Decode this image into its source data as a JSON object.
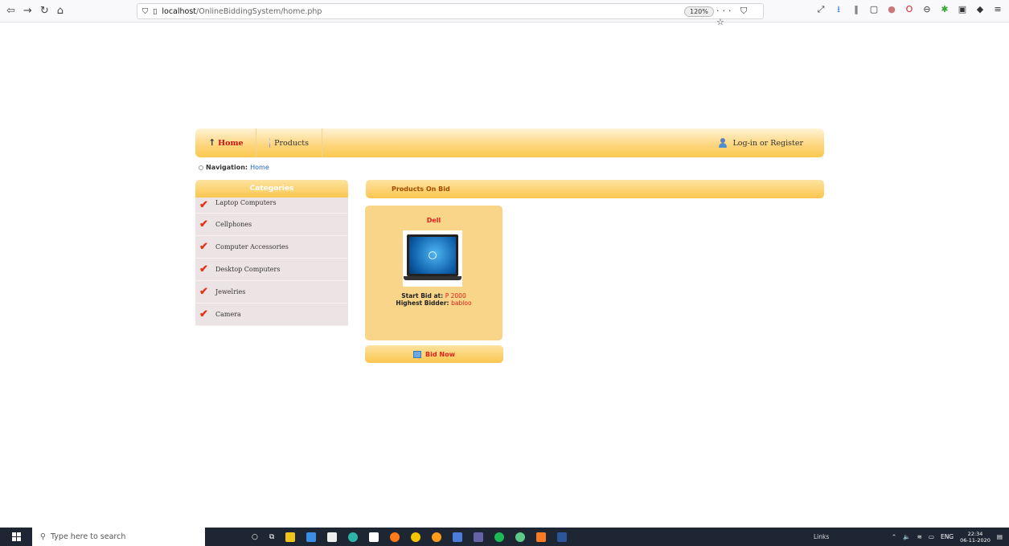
{
  "browser": {
    "url_host": "localhost",
    "url_path": "/OnlineBiddingSystem/home.php",
    "zoom": "120%",
    "back_icon": "back-arrow-icon",
    "forward_icon": "forward-arrow-icon",
    "reload_icon": "reload-icon",
    "home_icon": "home-icon"
  },
  "topnav": {
    "home_label": "Home",
    "products_label": "Products",
    "login_label": "Log-in or Register"
  },
  "breadcrumb": {
    "label": "Navigation:",
    "current": "Home"
  },
  "sidebar": {
    "header": "Categories",
    "items": [
      {
        "label": "Laptop Computers"
      },
      {
        "label": "Cellphones"
      },
      {
        "label": "Computer Accessories"
      },
      {
        "label": "Desktop Computers"
      },
      {
        "label": "Jewelries"
      },
      {
        "label": "Camera"
      }
    ]
  },
  "main": {
    "header": "Products On Bid",
    "product": {
      "name": "Dell",
      "start_bid_label": "Start Bid at:",
      "start_bid_value": "P 2000",
      "highest_bidder_label": "Highest Bidder:",
      "highest_bidder_value": "babloo",
      "bid_button": "Bid Now"
    }
  },
  "taskbar": {
    "search_placeholder": "Type here to search",
    "links": "Links",
    "lang": "ENG",
    "time": "22:34",
    "date": "06-11-2020"
  },
  "colors": {
    "nav_gradient_top": "#fff4d6",
    "nav_gradient_bottom": "#fbc94f",
    "accent_red": "#e02020",
    "category_bg": "#ece4e4",
    "card_bg": "#f9d58a"
  }
}
